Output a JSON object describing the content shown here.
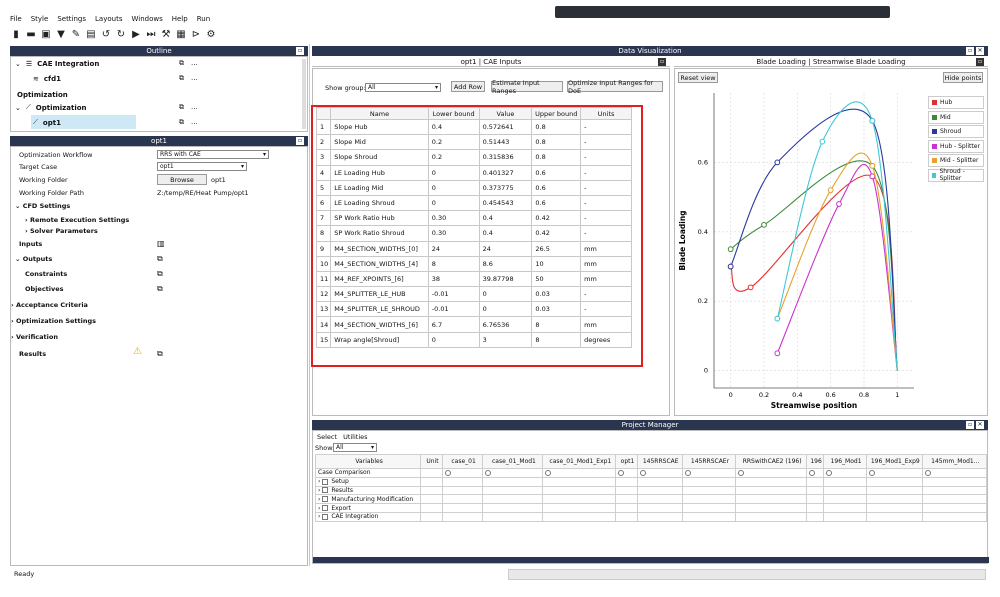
{
  "menu": [
    "File",
    "Style",
    "Settings",
    "Layouts",
    "Windows",
    "Help",
    "Run"
  ],
  "toolbar_icons": [
    "new-file-icon",
    "open-folder-icon",
    "save-icon",
    "download-icon",
    "edit-icon",
    "save-as-icon",
    "undo-icon",
    "redo-icon",
    "play-icon",
    "step-icon",
    "wrench-icon",
    "video-icon",
    "run-icon",
    "tool-icon"
  ],
  "outline": {
    "title": "Outline",
    "items": [
      {
        "label": "CAE Integration",
        "more": "..."
      },
      {
        "label": "cfd1",
        "more": "..."
      },
      {
        "label": "Optimization"
      },
      {
        "label": "Optimization",
        "more": "..."
      },
      {
        "label": "opt1",
        "more": "..."
      }
    ]
  },
  "props": {
    "title": "opt1",
    "workflow_label": "Optimization Workflow",
    "workflow_value": "RRS with CAE",
    "target_label": "Target Case",
    "target_value": "opt1",
    "folder_label": "Working Folder",
    "browse_label": "Browse",
    "folder_value": "opt1",
    "path_label": "Working Folder Path",
    "path_value": "Z:/temp/RE/Heat Pump/opt1",
    "sections": [
      {
        "label": "CFD Settings"
      },
      {
        "label": "Remote Execution Settings"
      },
      {
        "label": "Solver Parameters"
      },
      {
        "label": "Inputs"
      },
      {
        "label": "Outputs"
      },
      {
        "label": "Constraints"
      },
      {
        "label": "Objectives"
      },
      {
        "label": "Acceptance Criteria"
      },
      {
        "label": "Optimization Settings"
      },
      {
        "label": "Verification"
      },
      {
        "label": "Results"
      }
    ]
  },
  "status": "Ready",
  "data_viz": {
    "title": "Data Visualization"
  },
  "inputs": {
    "tab": "opt1 | CAE Inputs",
    "show_group_label": "Show group:",
    "show_group_value": "All",
    "add_row": "Add Row",
    "estimate": "Estimate Input Ranges",
    "optimize": "Optimize Input Ranges for DoE",
    "headers": [
      "",
      "Name",
      "Lower bound",
      "Value",
      "Upper bound",
      "Units"
    ],
    "rows": [
      [
        "1",
        "Slope Hub",
        "0.4",
        "0.572641",
        "0.8",
        "-"
      ],
      [
        "2",
        "Slope Mid",
        "0.2",
        "0.51443",
        "0.8",
        "-"
      ],
      [
        "3",
        "Slope Shroud",
        "0.2",
        "0.315836",
        "0.8",
        "-"
      ],
      [
        "4",
        "LE Loading Hub",
        "0",
        "0.401327",
        "0.6",
        "-"
      ],
      [
        "5",
        "LE Loading Mid",
        "0",
        "0.373775",
        "0.6",
        "-"
      ],
      [
        "6",
        "LE Loading Shroud",
        "0",
        "0.454543",
        "0.6",
        "-"
      ],
      [
        "7",
        "SP Work Ratio Hub",
        "0.30",
        "0.4",
        "0.42",
        "-"
      ],
      [
        "8",
        "SP Work Ratio Shroud",
        "0.30",
        "0.4",
        "0.42",
        "-"
      ],
      [
        "9",
        "M4_SECTION_WIDTHS_[0]",
        "24",
        "24",
        "26.5",
        "mm"
      ],
      [
        "10",
        "M4_SECTION_WIDTHS_[4]",
        "8",
        "8.6",
        "10",
        "mm"
      ],
      [
        "11",
        "M4_REF_XPOINTS_[6]",
        "38",
        "39.87798",
        "50",
        "mm"
      ],
      [
        "12",
        "M4_SPLITTER_LE_HUB",
        "-0.01",
        "0",
        "0.03",
        "-"
      ],
      [
        "13",
        "M4_SPLITTER_LE_SHROUD",
        "-0.01",
        "0",
        "0.03",
        "-"
      ],
      [
        "14",
        "M4_SECTION_WIDTHS_[6]",
        "6.7",
        "6.76536",
        "8",
        "mm"
      ],
      [
        "15",
        "Wrap angle[Shroud]",
        "0",
        "3",
        "8",
        "degrees"
      ]
    ]
  },
  "chart_panel": {
    "title": "Blade Loading | Streamwise Blade Loading",
    "reset": "Reset view",
    "hide": "Hide points"
  },
  "chart_data": {
    "type": "line",
    "xlabel": "Streamwise position",
    "ylabel": "Blade Loading",
    "xlim": [
      -0.1,
      1.1
    ],
    "ylim": [
      -0.05,
      0.8
    ],
    "xticks": [
      "0",
      "0.2",
      "0.4",
      "0.6",
      "0.8",
      "1"
    ],
    "yticks": [
      "0",
      "0.2",
      "0.4",
      "0.6"
    ],
    "series": [
      {
        "name": "Hub",
        "color": "#e03030",
        "points": [
          [
            0,
            0.3
          ],
          [
            0.12,
            0.24
          ],
          [
            0.85,
            0.56
          ],
          [
            1.0,
            0.0
          ]
        ]
      },
      {
        "name": "Mid",
        "color": "#3a8a3a",
        "points": [
          [
            0,
            0.35
          ],
          [
            0.2,
            0.42
          ],
          [
            0.85,
            0.59
          ],
          [
            1.0,
            0.0
          ]
        ]
      },
      {
        "name": "Shroud",
        "color": "#2a3aa0",
        "points": [
          [
            0,
            0.3
          ],
          [
            0.28,
            0.6
          ],
          [
            0.85,
            0.72
          ],
          [
            1.0,
            0.0
          ]
        ]
      },
      {
        "name": "Hub - Splitter",
        "color": "#cc33cc",
        "points": [
          [
            0.28,
            0.05
          ],
          [
            0.65,
            0.48
          ],
          [
            0.85,
            0.56
          ],
          [
            1.0,
            0.0
          ]
        ]
      },
      {
        "name": "Mid - Splitter",
        "color": "#e8a030",
        "points": [
          [
            0.28,
            0.15
          ],
          [
            0.6,
            0.52
          ],
          [
            0.85,
            0.59
          ],
          [
            1.0,
            0.0
          ]
        ]
      },
      {
        "name": "Shroud - Splitter",
        "color": "#40c8d8",
        "points": [
          [
            0.28,
            0.15
          ],
          [
            0.55,
            0.66
          ],
          [
            0.85,
            0.72
          ],
          [
            1.0,
            0.0
          ]
        ]
      }
    ]
  },
  "project_manager": {
    "title": "Project Manager",
    "menu": [
      "Select",
      "Utilities"
    ],
    "show_label": "Show:",
    "show_value": "All",
    "columns": [
      "Variables",
      "Unit",
      "case_01",
      "case_01_Mod1",
      "case_01_Mod1_Exp1",
      "opt1",
      "145RRSCAE",
      "145RRSCAEr",
      "RRSwithCAE2 (196)",
      "196",
      "196_Mod1",
      "196_Mod1_Exp9",
      "145mm_Mod1..."
    ],
    "rows": [
      "Case Comparison",
      "Setup",
      "Results",
      "Manufacturing Modification",
      "Export",
      "CAE Integration"
    ]
  }
}
